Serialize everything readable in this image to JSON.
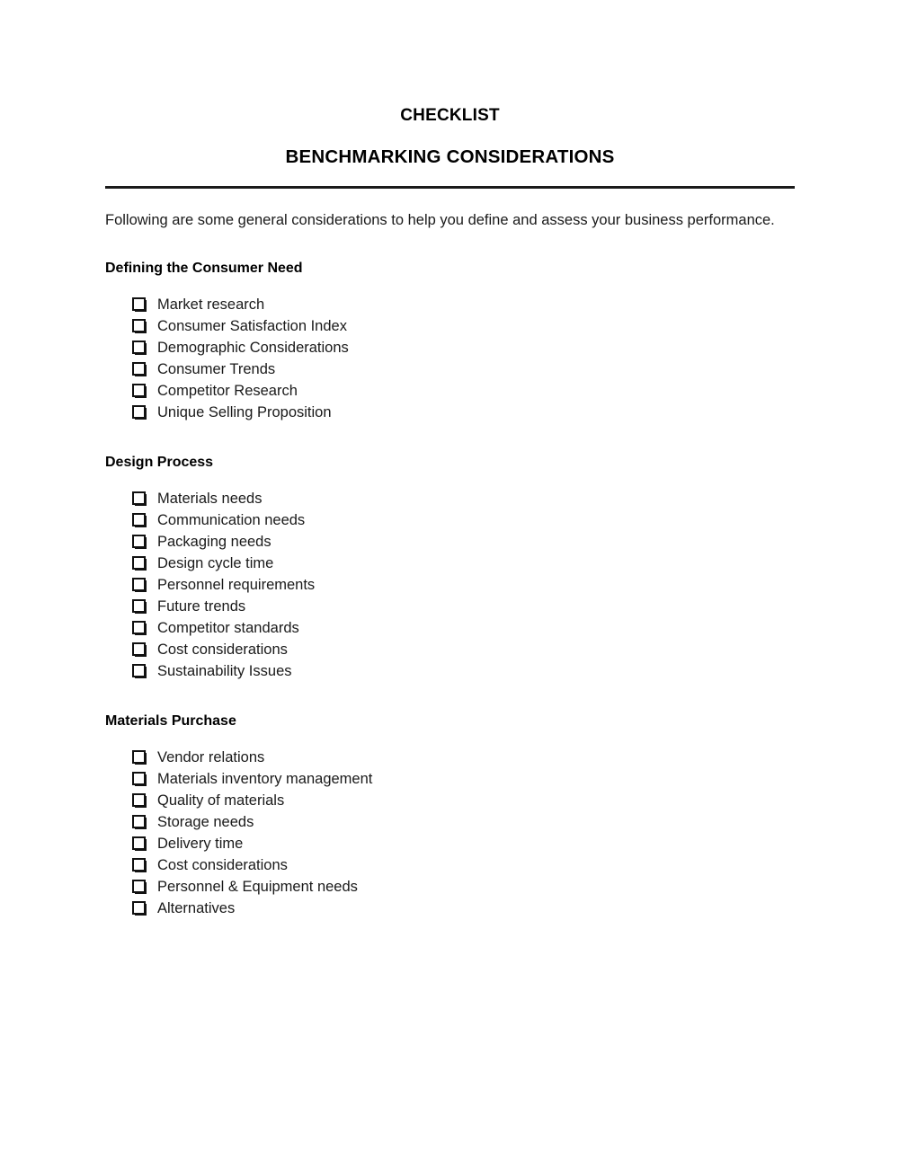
{
  "document": {
    "title": "CHECKLIST",
    "subtitle": "BENCHMARKING CONSIDERATIONS",
    "intro": "Following are some general considerations to help you define and assess your business performance.",
    "checkbox_icon": "empty-checkbox-icon",
    "rule_color": "#1a1a1a",
    "text_color": "#1a1a1a",
    "sections": [
      {
        "heading": "Defining the Consumer Need",
        "items": [
          "Market research",
          "Consumer Satisfaction Index",
          "Demographic Considerations",
          "Consumer Trends",
          "Competitor Research",
          "Unique Selling Proposition"
        ]
      },
      {
        "heading": "Design Process",
        "items": [
          "Materials needs",
          "Communication needs",
          "Packaging needs",
          "Design cycle time",
          "Personnel requirements",
          "Future trends",
          "Competitor standards",
          "Cost considerations",
          "Sustainability Issues"
        ]
      },
      {
        "heading": "Materials Purchase",
        "items": [
          "Vendor relations",
          "Materials inventory management",
          "Quality of materials",
          "Storage needs",
          "Delivery time",
          "Cost considerations",
          "Personnel & Equipment needs",
          "Alternatives"
        ]
      }
    ]
  }
}
